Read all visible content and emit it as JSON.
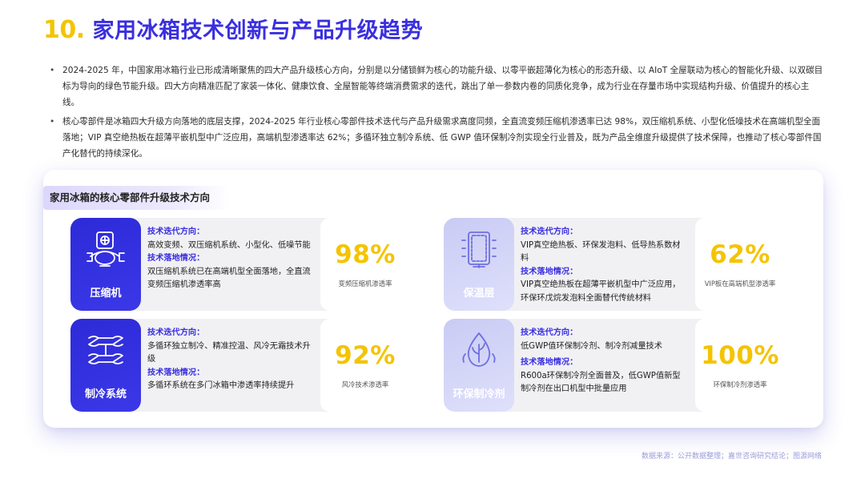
{
  "header": {
    "number": "10.",
    "title": "家用冰箱技术创新与产品升级趋势"
  },
  "bullets": [
    "2024-2025 年，中国家用冰箱行业已形成清晰聚焦的四大产品升级核心方向，分别是以分储锁鲜为核心的功能升级、以零平嵌超薄化为核心的形态升级、以 AIoT 全屋联动为核心的智能化升级、以双碳目标为导向的绿色节能升级。四大方向精准匹配了家装一体化、健康饮食、全屋智能等终端消费需求的迭代，跳出了单一参数内卷的同质化竞争，成为行业在存量市场中实现结构升级、价值提升的核心主线。",
    "核心零部件是冰箱四大升级方向落地的底层支撑，2024-2025 年行业核心零部件技术迭代与产品升级需求高度同频，全直流变频压缩机渗透率已达 98%，双压缩机系统、小型化低噪技术在高端机型全面落地；VIP 真空绝热板在超薄平嵌机型中广泛应用，高端机型渗透率达 62%；多循环独立制冷系统、低 GWP 值环保制冷剂实现全行业普及，既为产品全维度升级提供了技术保障，也推动了核心零部件国产化替代的持续深化。"
  ],
  "panel": {
    "title": "家用冰箱的核心零部件升级技术方向",
    "cards": [
      {
        "name": "压缩机",
        "icon": "compressor-icon",
        "iter_heading": "技术迭代方向：",
        "iter_text": "高效变频、双压缩机系统、小型化、低噪节能",
        "land_heading": "技术落地情况：",
        "land_text": "双压缩机系统已在高端机型全面落地，全直流变频压缩机渗透率高",
        "stat_value": "98%",
        "stat_caption": "变频压缩机渗透率"
      },
      {
        "name": "保温层",
        "icon": "insulation-panel-icon",
        "iter_heading": "技术迭代方向：",
        "iter_text": "VIP真空绝热板、环保发泡料、低导热系数材料",
        "land_heading": "技术落地情况：",
        "land_text": "VIP真空绝热板在超薄平嵌机型中广泛应用，环保环戊烷发泡料全面替代传统材料",
        "stat_value": "62%",
        "stat_caption": "VIP板在高端机型渗透率"
      },
      {
        "name": "制冷系统",
        "icon": "refrigeration-coil-icon",
        "iter_heading": "技术迭代方向：",
        "iter_text": "多循环独立制冷、精准控温、风冷无霜技术升级",
        "land_heading": "技术落地情况：",
        "land_text": "多循环系统在多门冰箱中渗透率持续提升",
        "stat_value": "92%",
        "stat_caption": "风冷技术渗透率"
      },
      {
        "name": "环保制冷剂",
        "icon": "eco-leaf-drop-icon",
        "iter_heading": "技术迭代方向：",
        "iter_text": "低GWP值环保制冷剂、制冷剂减量技术",
        "land_heading": "技术落地情况：",
        "land_text": "R600a环保制冷剂全面普及，低GWP值新型制冷剂在出口机型中批量应用",
        "stat_value": "100%",
        "stat_caption": "环保制冷剂渗透率"
      }
    ]
  },
  "footer": {
    "source": "数据来源：公开数据整理；嘉世咨询研究结论；图源网络"
  },
  "colors": {
    "accent_yellow": "#f4c400",
    "brand_blue": "#3a2fe0"
  }
}
